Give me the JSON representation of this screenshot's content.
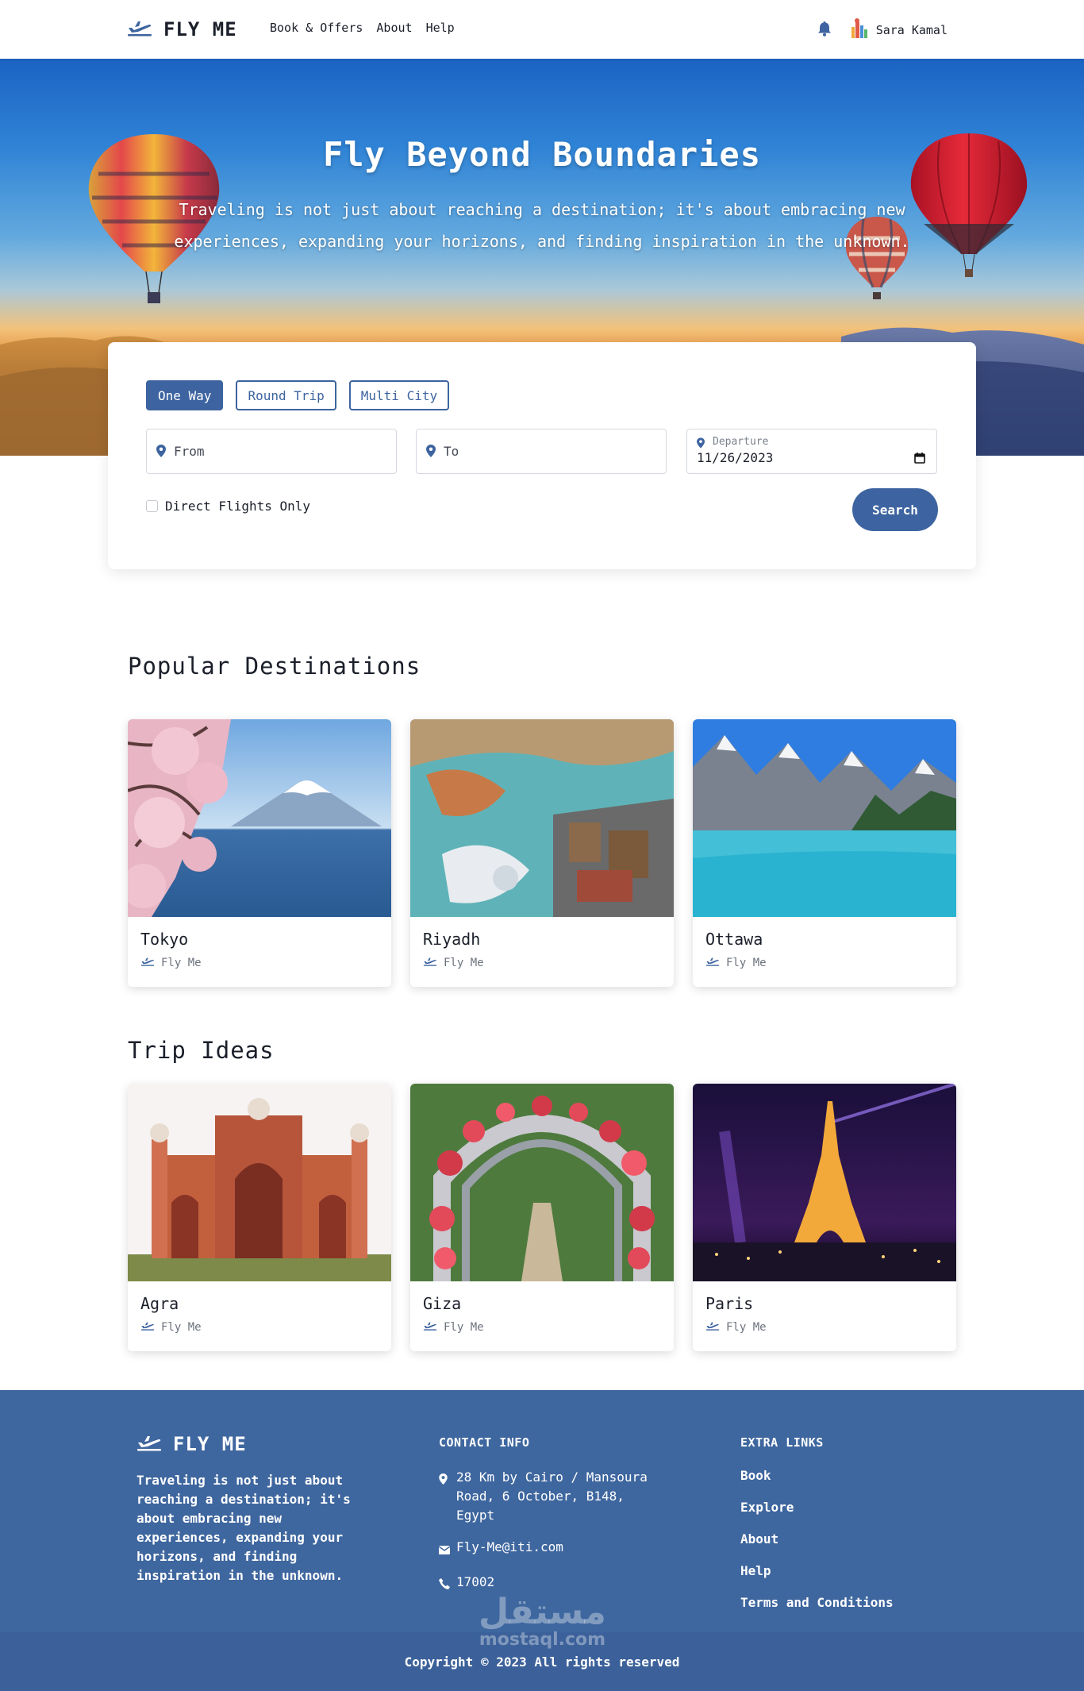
{
  "nav": {
    "brand": "FLY ME",
    "links": [
      "Book & Offers",
      "About",
      "Help"
    ],
    "user_name": "Sara Kamal"
  },
  "hero": {
    "title": "Fly Beyond Boundaries",
    "subtitle": "Traveling is not just about reaching a destination; it's about embracing new experiences, expanding your horizons, and finding inspiration in the unknown."
  },
  "search": {
    "trip_types": [
      "One Way",
      "Round Trip",
      "Multi City"
    ],
    "active_trip_type": "One Way",
    "from_placeholder": "From",
    "to_placeholder": "To",
    "departure_label": "Departure",
    "departure_value": "11/26/2023",
    "direct_label": "Direct Flights Only",
    "direct_checked": false,
    "search_label": "Search"
  },
  "popular": {
    "title": "Popular Destinations",
    "items": [
      {
        "name": "Tokyo",
        "brand": "Fly Me"
      },
      {
        "name": "Riyadh",
        "brand": "Fly Me"
      },
      {
        "name": "Ottawa",
        "brand": "Fly Me"
      }
    ]
  },
  "ideas": {
    "title": "Trip Ideas",
    "items": [
      {
        "name": "Agra",
        "brand": "Fly Me"
      },
      {
        "name": "Giza",
        "brand": "Fly Me"
      },
      {
        "name": "Paris",
        "brand": "Fly Me"
      }
    ]
  },
  "footer": {
    "brand": "FLY ME",
    "about": "Traveling is not just about reaching a destination; it's about embracing new experiences, expanding your horizons, and finding inspiration in the unknown.",
    "contact_heading": "CONTACT INFO",
    "address": "28 Km by Cairo / Mansoura Road, 6 October, B148, Egypt",
    "email": "Fly-Me@iti.com",
    "phone": "17002",
    "links_heading": "EXTRA LINKS",
    "links": [
      "Book",
      "Explore",
      "About",
      "Help",
      "Terms and Conditions"
    ],
    "copyright": "Copyright © 2023 All rights reserved"
  },
  "watermark": {
    "arabic": "مستقل",
    "latin": "mostaql.com"
  },
  "colors": {
    "primary": "#3d64a0",
    "footer": "#3f679f"
  },
  "icons": [
    "plane-icon",
    "bell-icon",
    "map-pin-icon",
    "calendar-icon",
    "envelope-icon",
    "phone-icon"
  ]
}
